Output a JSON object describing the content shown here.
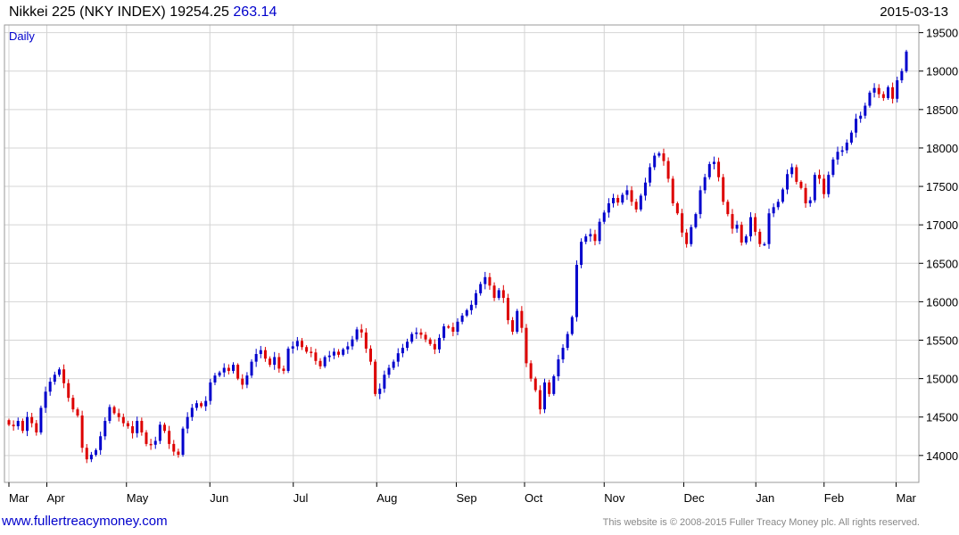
{
  "header": {
    "title": "Nikkei 225 (NKY INDEX)",
    "last": "19254.25",
    "change": "263.14",
    "date": "2015-03-13"
  },
  "footer": {
    "url": "www.fullertreacymoney.com",
    "copyright": "This website is © 2008-2015 Fuller Treacy Money plc. All rights reserved."
  },
  "chart_data": {
    "type": "candlestick",
    "period_label": "Daily",
    "ylim": [
      13650,
      19600
    ],
    "yticks": [
      14000,
      14500,
      15000,
      15500,
      16000,
      16500,
      17000,
      17500,
      18000,
      18500,
      19000,
      19500
    ],
    "months": [
      "Mar",
      "Apr",
      "May",
      "Jun",
      "Jul",
      "Aug",
      "Sep",
      "Oct",
      "Nov",
      "Dec",
      "Jan",
      "Feb",
      "Mar"
    ],
    "colors": {
      "up": "#0000cc",
      "down": "#dd0000",
      "grid": "#d4d4d4",
      "axis": "#000000",
      "label": "#0000cc"
    },
    "grid": true,
    "closes": [
      14400,
      14380,
      14450,
      14320,
      14500,
      14420,
      14300,
      14620,
      14830,
      14960,
      15050,
      15120,
      14940,
      14750,
      14600,
      14520,
      14100,
      13950,
      14010,
      14070,
      14250,
      14450,
      14630,
      14550,
      14500,
      14420,
      14380,
      14290,
      14450,
      14300,
      14150,
      14140,
      14190,
      14400,
      14320,
      14150,
      14050,
      14010,
      14350,
      14500,
      14620,
      14680,
      14640,
      14710,
      14950,
      15040,
      15080,
      15140,
      15100,
      15180,
      15000,
      14920,
      15040,
      15220,
      15320,
      15370,
      15260,
      15180,
      15280,
      15130,
      15100,
      15390,
      15420,
      15490,
      15410,
      15350,
      15340,
      15230,
      15160,
      15280,
      15300,
      15350,
      15310,
      15380,
      15420,
      15510,
      15640,
      15600,
      15390,
      15220,
      14800,
      14870,
      15050,
      15140,
      15220,
      15330,
      15400,
      15480,
      15580,
      15600,
      15570,
      15510,
      15450,
      15380,
      15530,
      15680,
      15670,
      15610,
      15740,
      15820,
      15890,
      15960,
      16110,
      16230,
      16320,
      16210,
      16050,
      16150,
      16050,
      15760,
      15610,
      15880,
      15660,
      15200,
      15000,
      14850,
      14600,
      14950,
      14800,
      15030,
      15250,
      15400,
      15580,
      15800,
      16480,
      16780,
      16850,
      16880,
      16790,
      17040,
      17160,
      17280,
      17350,
      17290,
      17390,
      17450,
      17300,
      17200,
      17380,
      17550,
      17750,
      17900,
      17930,
      17830,
      17600,
      17280,
      17150,
      16900,
      16750,
      16970,
      17140,
      17450,
      17620,
      17790,
      17820,
      17620,
      17300,
      17140,
      16950,
      17000,
      16770,
      16850,
      17100,
      16910,
      16750,
      16750,
      17150,
      17230,
      17300,
      17460,
      17660,
      17750,
      17560,
      17480,
      17280,
      17320,
      17650,
      17600,
      17400,
      17650,
      17850,
      17950,
      17970,
      18070,
      18200,
      18380,
      18420,
      18550,
      18720,
      18780,
      18700,
      18650,
      18790,
      18640,
      18880,
      19000,
      19254.25
    ]
  }
}
